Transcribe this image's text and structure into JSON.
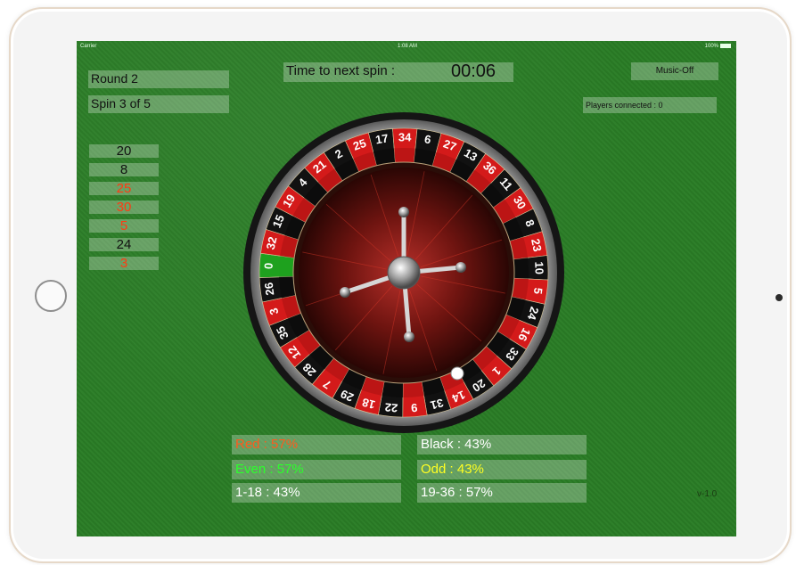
{
  "status_bar": {
    "carrier": "Carrier",
    "time": "1:08 AM",
    "battery": "100%"
  },
  "round_label": "Round 2",
  "spin_label": "Spin 3 of 5",
  "timer": {
    "label": "Time to next spin    :",
    "value": "00:06"
  },
  "music_button": "Music-Off",
  "players_connected": "Players connected : 0",
  "history": [
    {
      "value": "20",
      "color": "black"
    },
    {
      "value": "8",
      "color": "black"
    },
    {
      "value": "25",
      "color": "red"
    },
    {
      "value": "30",
      "color": "red"
    },
    {
      "value": "5",
      "color": "red"
    },
    {
      "value": "24",
      "color": "black"
    },
    {
      "value": "3",
      "color": "red"
    }
  ],
  "stats": {
    "red": "Red   : 57%",
    "black": "Black : 43%",
    "even": "Even  : 57%",
    "odd": "Odd  : 43%",
    "low": "1-18  : 43%",
    "high": "19-36 : 57%"
  },
  "version": "v-1.0",
  "wheel": {
    "sequence": [
      "0",
      "32",
      "15",
      "19",
      "4",
      "21",
      "2",
      "25",
      "17",
      "34",
      "6",
      "27",
      "13",
      "36",
      "11",
      "30",
      "8",
      "23",
      "10",
      "5",
      "24",
      "16",
      "33",
      "1",
      "20",
      "14",
      "31",
      "9",
      "22",
      "18",
      "29",
      "7",
      "28",
      "12",
      "35",
      "3",
      "26"
    ],
    "red_numbers": [
      "1",
      "3",
      "5",
      "7",
      "9",
      "12",
      "14",
      "16",
      "18",
      "19",
      "21",
      "23",
      "25",
      "27",
      "30",
      "32",
      "34",
      "36"
    ],
    "colors": {
      "red": "#d41a1a",
      "black": "#111111",
      "green": "#1fa11f"
    }
  }
}
